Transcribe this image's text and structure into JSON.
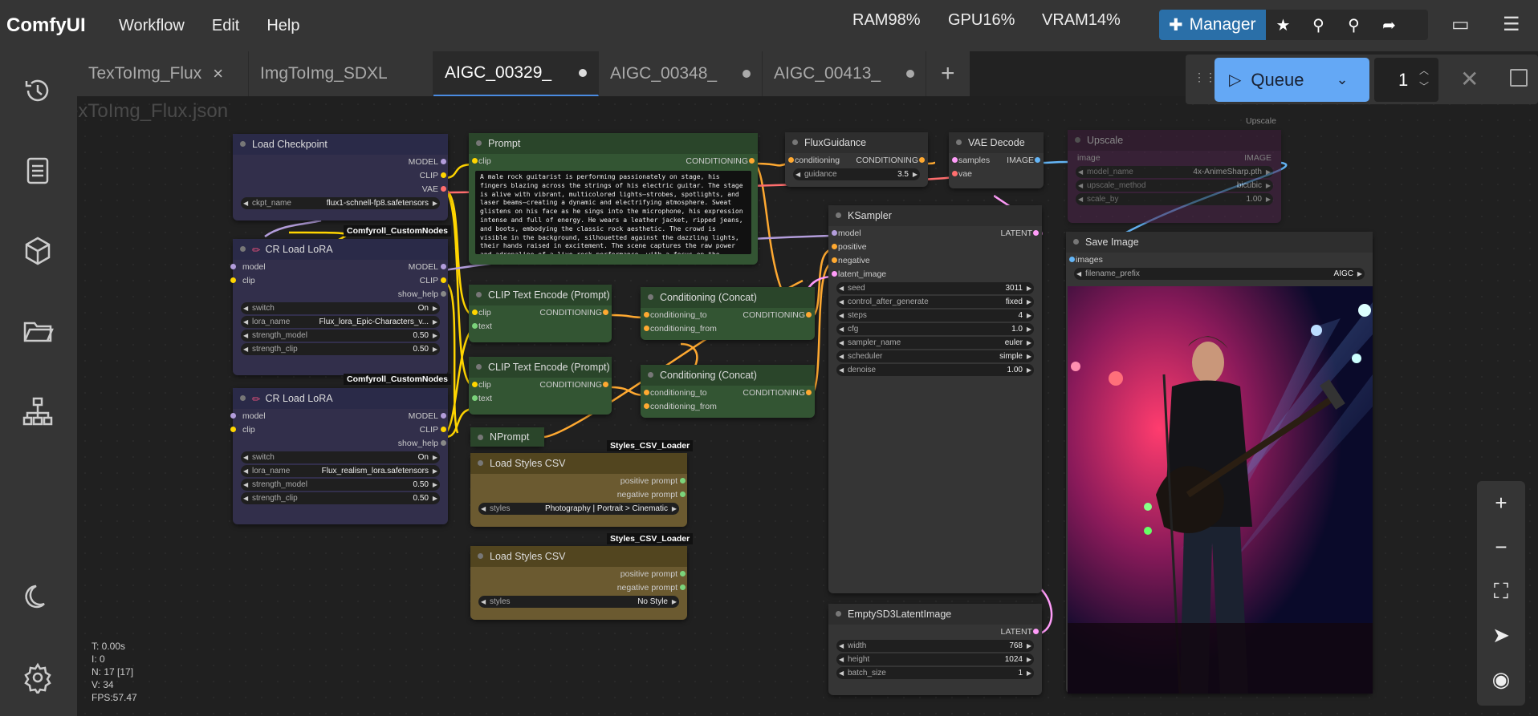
{
  "app": {
    "name": "ComfyUI"
  },
  "menu": [
    "Workflow",
    "Edit",
    "Help"
  ],
  "stats": {
    "ram": "RAM98%",
    "gpu": "GPU16%",
    "vram": "VRAM14%"
  },
  "manager": {
    "label": "Manager"
  },
  "tabs": [
    {
      "label": "TexToImg_Flux",
      "close": "×"
    },
    {
      "label": "ImgToImg_SDXL"
    },
    {
      "label": "AIGC_00329_"
    },
    {
      "label": "AIGC_00348_"
    },
    {
      "label": "AIGC_00413_"
    }
  ],
  "tab_add": "+",
  "workflow_file": "TexToImg_Flux.json",
  "queue": {
    "label": "Queue",
    "count": "1"
  },
  "nodes": {
    "load_checkpoint": {
      "title": "Load Checkpoint",
      "out_model": "MODEL",
      "out_clip": "CLIP",
      "out_vae": "VAE",
      "ckpt_label": "ckpt_name",
      "ckpt_value": "flux1-schnell-fp8.safetensors"
    },
    "tag1": "Comfyroll_CustomNodes",
    "tag2": "Comfyroll_CustomNodes",
    "lora1": {
      "title": "CR Load LoRA",
      "in_model": "model",
      "in_clip": "clip",
      "out_model": "MODEL",
      "out_clip": "CLIP",
      "out_help": "show_help",
      "switch_label": "switch",
      "switch_value": "On",
      "lora_label": "lora_name",
      "lora_value": "Flux_lora_Epic-Characters_v...",
      "sm_label": "strength_model",
      "sm_value": "0.50",
      "sc_label": "strength_clip",
      "sc_value": "0.50"
    },
    "lora2": {
      "title": "CR Load LoRA",
      "in_model": "model",
      "in_clip": "clip",
      "out_model": "MODEL",
      "out_clip": "CLIP",
      "out_help": "show_help",
      "switch_label": "switch",
      "switch_value": "On",
      "lora_label": "lora_name",
      "lora_value": "Flux_realism_lora.safetensors",
      "sm_label": "strength_model",
      "sm_value": "0.50",
      "sc_label": "strength_clip",
      "sc_value": "0.50"
    },
    "prompt": {
      "title": "Prompt",
      "in_clip": "clip",
      "out": "CONDITIONING",
      "text": "A male rock guitarist is performing passionately on stage, his fingers blazing across the strings of his electric guitar. The stage is alive with vibrant, multicolored lights—strobes, spotlights, and laser beams—creating a dynamic and electrifying atmosphere. Sweat glistens on his face as he sings into the microphone, his expression intense and full of energy. He wears a leather jacket, ripped jeans, and boots, embodying the classic rock aesthetic. The crowd is visible in the background, silhouetted against the dazzling lights, their hands raised in excitement. The scene captures the raw power and adrenaline of a live rock performance, with a focus on the"
    },
    "clip1": {
      "title": "CLIP Text Encode (Prompt)",
      "in_clip": "clip",
      "in_text": "text",
      "out": "CONDITIONING"
    },
    "clip2": {
      "title": "CLIP Text Encode (Prompt)",
      "in_clip": "clip",
      "in_text": "text",
      "out": "CONDITIONING"
    },
    "concat1": {
      "title": "Conditioning (Concat)",
      "in_to": "conditioning_to",
      "in_from": "conditioning_from",
      "out": "CONDITIONING"
    },
    "concat2": {
      "title": "Conditioning (Concat)",
      "in_to": "conditioning_to",
      "in_from": "conditioning_from",
      "out": "CONDITIONING"
    },
    "nprompt": {
      "title": "NPrompt"
    },
    "tag3": "Styles_CSV_Loader",
    "tag4": "Styles_CSV_Loader",
    "styles1": {
      "title": "Load Styles CSV",
      "out_pos": "positive prompt",
      "out_neg": "negative prompt",
      "styles_label": "styles",
      "styles_value": "Photography | Portrait > Cinematic"
    },
    "styles2": {
      "title": "Load Styles CSV",
      "out_pos": "positive prompt",
      "out_neg": "negative prompt",
      "styles_label": "styles",
      "styles_value": "No Style"
    },
    "fluxguidance": {
      "title": "FluxGuidance",
      "in": "conditioning",
      "out": "CONDITIONING",
      "g_label": "guidance",
      "g_value": "3.5"
    },
    "vaedecode": {
      "title": "VAE Decode",
      "in_samples": "samples",
      "in_vae": "vae",
      "out": "IMAGE"
    },
    "upscale_tag": "Upscale",
    "upscale": {
      "title": "Upscale",
      "in_image": "image",
      "out": "IMAGE",
      "w1_label": "model_name",
      "w1_value": "4x-AnimeSharp.pth",
      "w2_label": "upscale_method",
      "w2_value": "bicubic",
      "w3_label": "scale_by",
      "w3_value": "1.00"
    },
    "ksampler": {
      "title": "KSampler",
      "in_model": "model",
      "in_pos": "positive",
      "in_neg": "negative",
      "in_latent": "latent_image",
      "out": "LATENT",
      "widgets": [
        {
          "label": "seed",
          "value": "3011"
        },
        {
          "label": "control_after_generate",
          "value": "fixed"
        },
        {
          "label": "steps",
          "value": "4"
        },
        {
          "label": "cfg",
          "value": "1.0"
        },
        {
          "label": "sampler_name",
          "value": "euler"
        },
        {
          "label": "scheduler",
          "value": "simple"
        },
        {
          "label": "denoise",
          "value": "1.00"
        }
      ]
    },
    "saveimage": {
      "title": "Save Image",
      "in": "images",
      "fp_label": "filename_prefix",
      "fp_value": "AIGC"
    },
    "latent": {
      "title": "EmptySD3LatentImage",
      "out": "LATENT",
      "w_label": "width",
      "w_value": "768",
      "h_label": "height",
      "h_value": "1024",
      "b_label": "batch_size",
      "b_value": "1"
    }
  },
  "perf": {
    "t": "T: 0.00s",
    "i": "I: 0",
    "n": "N: 17 [17]",
    "v": "V: 34",
    "fps": "FPS:57.47"
  },
  "colors": {
    "accent": "#64a8f5",
    "manager": "#2a6fa8",
    "link_model": "#b39ddb",
    "link_clip": "#ffd500",
    "link_cond": "#ffa931",
    "link_vae": "#ff6e6e",
    "link_image": "#64b5f6",
    "link_latent": "#ff9cf9"
  }
}
